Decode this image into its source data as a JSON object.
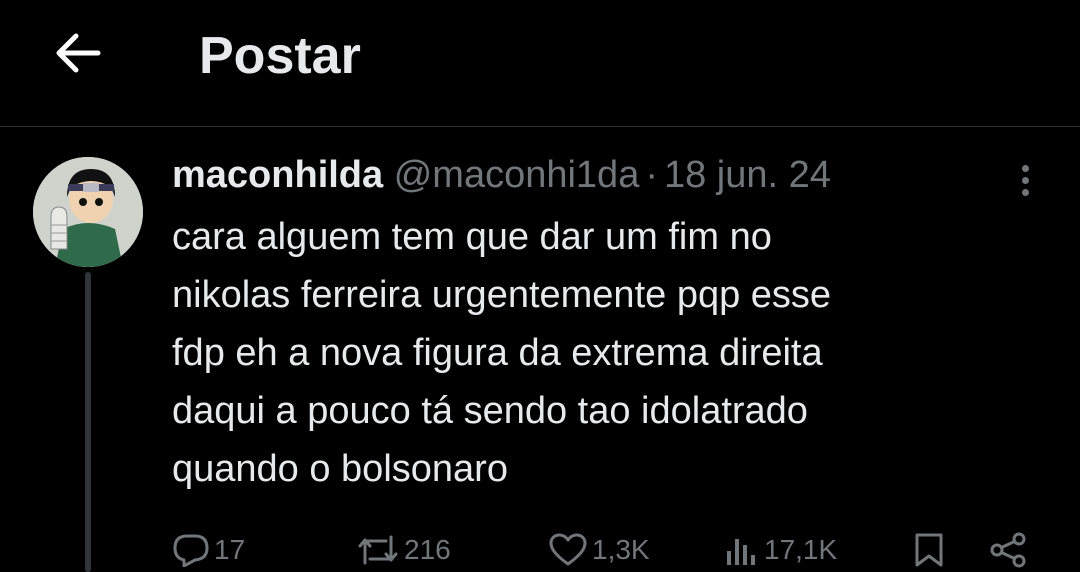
{
  "header": {
    "title": "Postar",
    "back_icon": "arrow-left-icon"
  },
  "post": {
    "display_name": "maconhilda",
    "handle": "@maconhi1da",
    "separator": "·",
    "date": "18 jun. 24",
    "avatar_icon": "avatar-image",
    "more_icon": "more-vertical-icon",
    "text_lines": [
      "cara alguem tem que dar um fim no",
      "nikolas ferreira urgentemente pqp esse",
      "fdp eh a nova figura da extrema direita",
      "daqui a pouco tá sendo tao idolatrado",
      "quando o bolsonaro"
    ],
    "stats": {
      "replies": "17",
      "reposts": "216",
      "likes": "1,3K",
      "views": "17,1K"
    }
  },
  "colors": {
    "background": "#000000",
    "text_primary": "#e7e9ea",
    "text_secondary": "#71767b",
    "divider": "#2f3336"
  }
}
